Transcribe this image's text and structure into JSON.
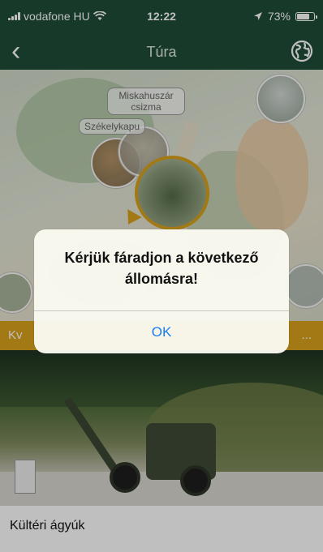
{
  "status_bar": {
    "carrier": "vodafone HU",
    "time": "12:22",
    "battery": "73%"
  },
  "nav": {
    "back_glyph": "‹",
    "title": "Túra",
    "globe_icon": "globe-icon"
  },
  "map": {
    "labels": [
      "Miskahuszár csizma",
      "Székelykapu"
    ]
  },
  "band": {
    "left_text": "Kv",
    "right_text": "..."
  },
  "photo": {
    "caption": "Kültéri ágyúk"
  },
  "alert": {
    "message": "Kérjük fáradjon a következő állomásra!",
    "ok_label": "OK"
  },
  "colors": {
    "nav_bg": "#1f4c38",
    "accent": "#d8a21b",
    "alert_button": "#1a7cf5"
  }
}
